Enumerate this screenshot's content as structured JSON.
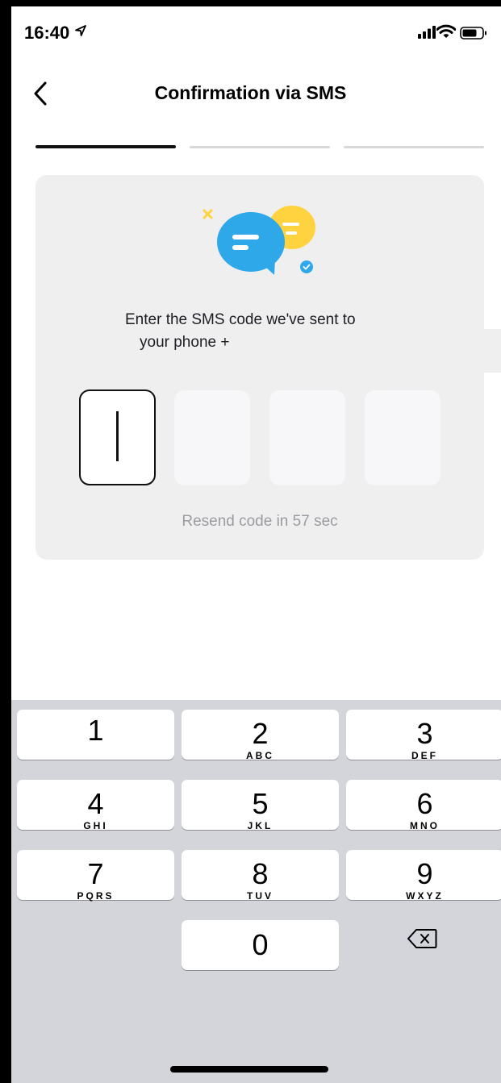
{
  "status_bar": {
    "time": "16:40",
    "location_icon": "location-arrow-icon",
    "signal_icon": "cellular-signal-icon",
    "wifi_icon": "wifi-icon",
    "battery_icon": "battery-icon"
  },
  "nav": {
    "back_icon": "chevron-left-icon",
    "title": "Confirmation via SMS"
  },
  "progress": {
    "total_steps": 3,
    "current_step": 1
  },
  "card": {
    "illustration_icon": "chat-bubbles-icon",
    "instruction_line1": "Enter the SMS code we've sent to",
    "instruction_line2": "your phone +",
    "code_digits": [
      "",
      "",
      "",
      ""
    ],
    "resend_text": "Resend code in 57 sec"
  },
  "keyboard": {
    "keys": [
      {
        "digit": "1",
        "letters": ""
      },
      {
        "digit": "2",
        "letters": "ABC"
      },
      {
        "digit": "3",
        "letters": "DEF"
      },
      {
        "digit": "4",
        "letters": "GHI"
      },
      {
        "digit": "5",
        "letters": "JKL"
      },
      {
        "digit": "6",
        "letters": "MNO"
      },
      {
        "digit": "7",
        "letters": "PQRS"
      },
      {
        "digit": "8",
        "letters": "TUV"
      },
      {
        "digit": "9",
        "letters": "WXYZ"
      },
      {
        "digit": "0",
        "letters": ""
      }
    ],
    "delete_icon": "backspace-icon"
  },
  "colors": {
    "bubble_blue": "#2ea8e8",
    "bubble_yellow": "#ffd23f",
    "card_bg": "#efeff0",
    "keyboard_bg": "#d3d5db"
  }
}
